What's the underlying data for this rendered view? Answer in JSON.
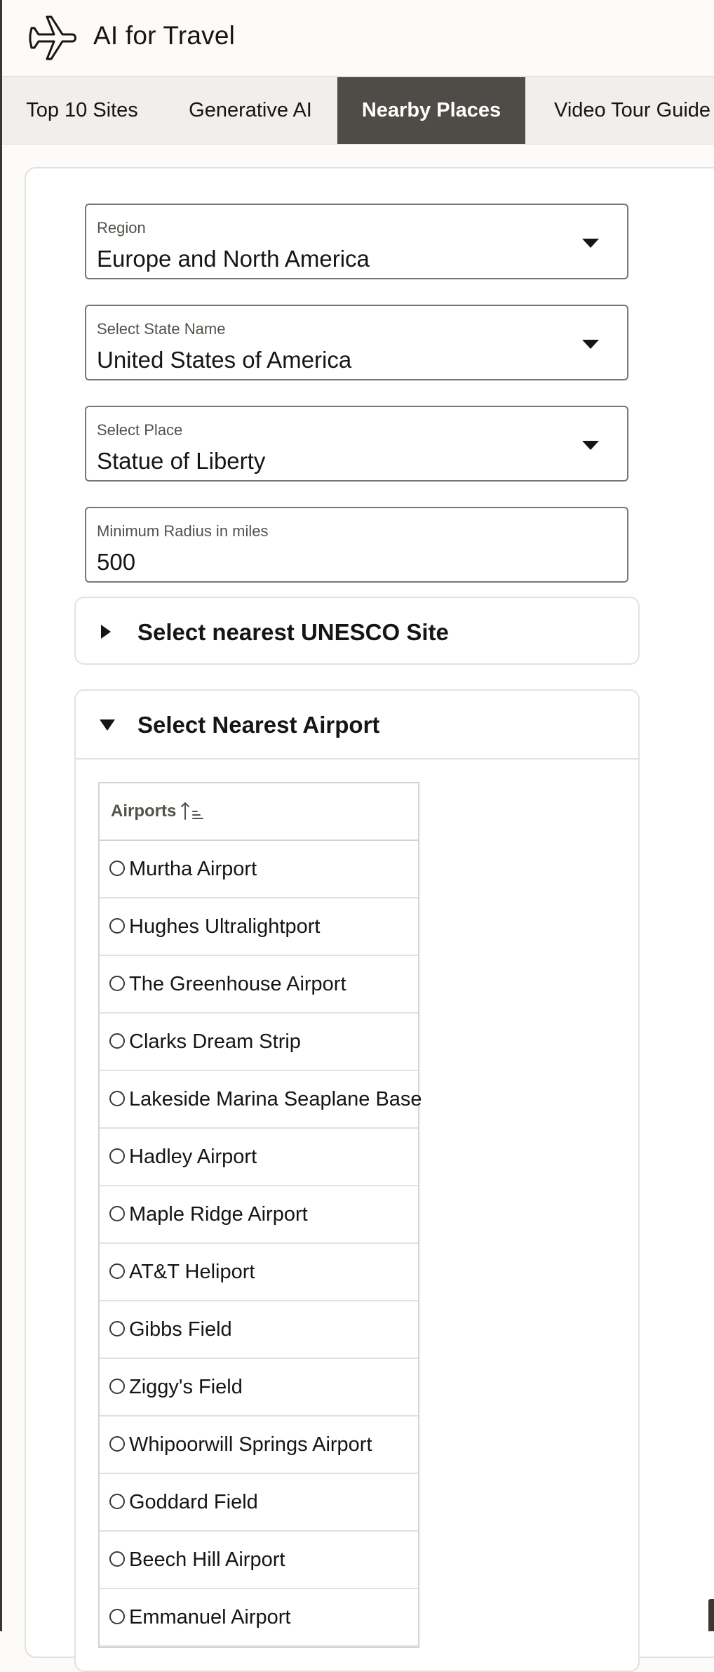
{
  "app": {
    "title": "AI for Travel",
    "logo_icon": "airplane-icon"
  },
  "tabs": [
    {
      "label": "Top 10 Sites",
      "active": false
    },
    {
      "label": "Generative AI",
      "active": false
    },
    {
      "label": "Nearby Places",
      "active": true
    },
    {
      "label": "Video Tour Guide",
      "active": false
    }
  ],
  "form": {
    "region": {
      "label": "Region",
      "value": "Europe and North America"
    },
    "state": {
      "label": "Select State Name",
      "value": "United States of America"
    },
    "place": {
      "label": "Select Place",
      "value": "Statue of Liberty"
    },
    "radius": {
      "label": "Minimum Radius in miles",
      "value": "500"
    }
  },
  "sections": {
    "unesco": {
      "title": "Select nearest UNESCO Site",
      "expanded": false
    },
    "airport": {
      "title": "Select Nearest Airport",
      "expanded": true
    }
  },
  "airports_table": {
    "header": "Airports",
    "sort_icon": "sort-ascending-icon",
    "rows": [
      "Murtha Airport",
      "Hughes Ultralightport",
      "The Greenhouse Airport",
      "Clarks Dream Strip",
      "Lakeside Marina Seaplane Base",
      "Hadley Airport",
      "Maple Ridge Airport",
      "AT&T Heliport",
      "Gibbs Field",
      "Ziggy's Field",
      "Whipoorwill Springs Airport",
      "Goddard Field",
      "Beech Hill Airport",
      "Emmanuel Airport"
    ]
  },
  "colors": {
    "active_tab_bg": "#4f4b46",
    "tabbar_bg": "#f1efed",
    "text": "#161513"
  }
}
